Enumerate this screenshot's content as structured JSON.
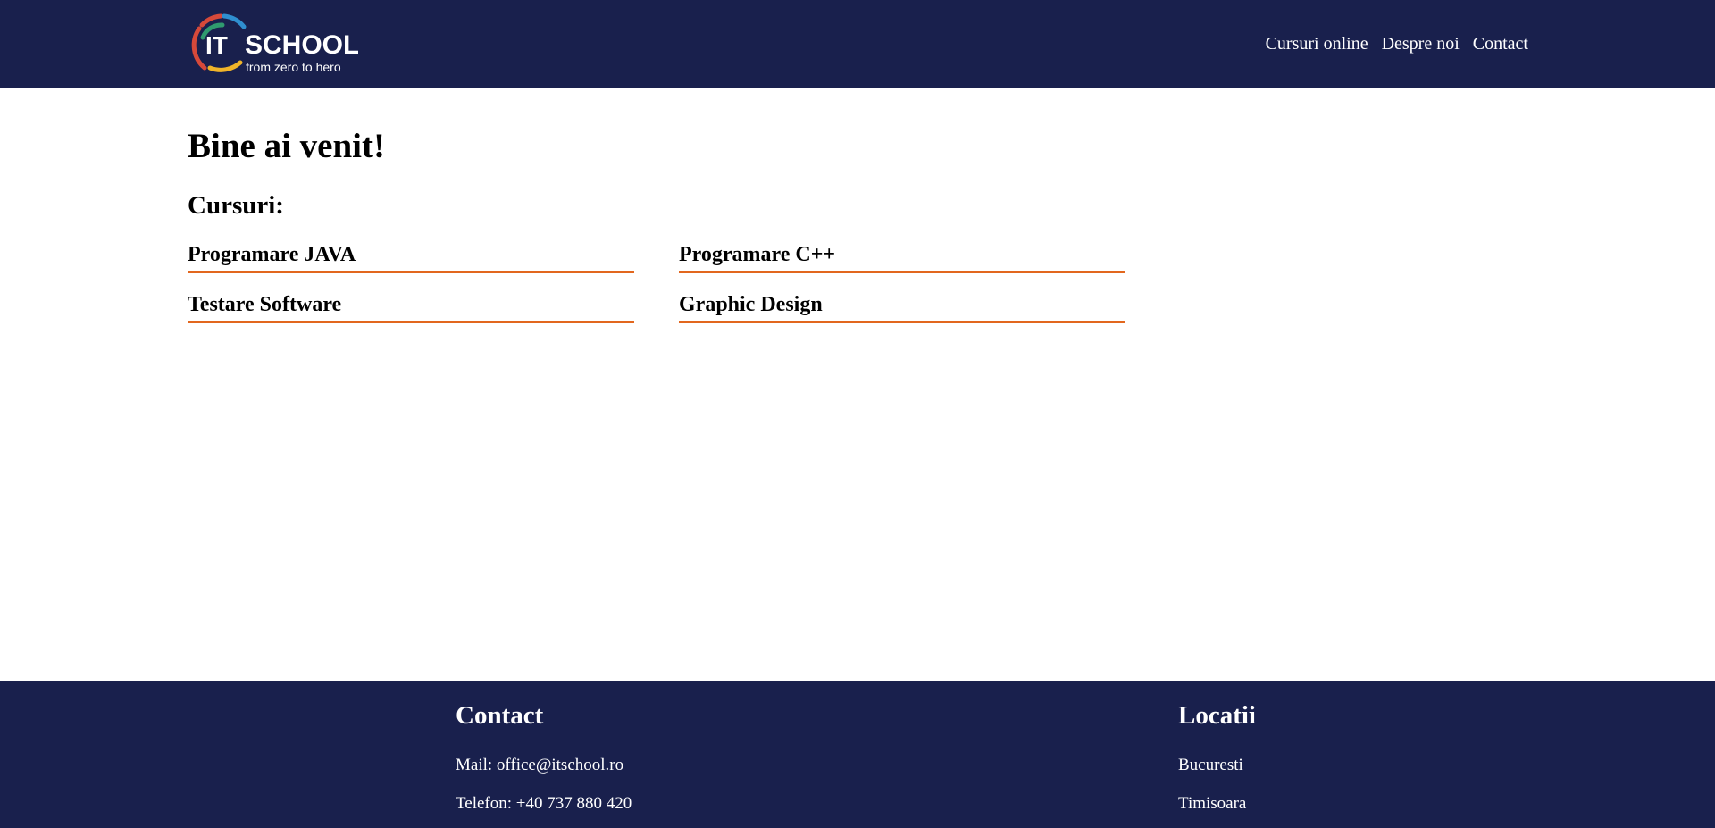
{
  "header": {
    "logo": {
      "brand_it": "IT",
      "brand_school": "SCHOOL",
      "tagline": "from zero to hero",
      "colors": [
        "#d6493a",
        "#2f9a6f",
        "#2f8fd0",
        "#f0b429"
      ]
    },
    "nav": [
      {
        "label": "Cursuri online"
      },
      {
        "label": "Despre noi"
      },
      {
        "label": "Contact"
      }
    ],
    "background": "#19204d"
  },
  "main": {
    "title": "Bine ai venit!",
    "courses_heading": "Cursuri:",
    "courses": [
      {
        "label": "Programare JAVA"
      },
      {
        "label": "Programare C++"
      },
      {
        "label": "Testare Software"
      },
      {
        "label": "Graphic Design"
      }
    ],
    "accent": "#e2671e"
  },
  "footer": {
    "contact": {
      "title": "Contact",
      "mail": "Mail: office@itschool.ro",
      "phone": "Telefon: +40 737 880 420"
    },
    "locations": {
      "title": "Locatii",
      "items": [
        "Bucuresti",
        "Timisoara"
      ]
    }
  }
}
